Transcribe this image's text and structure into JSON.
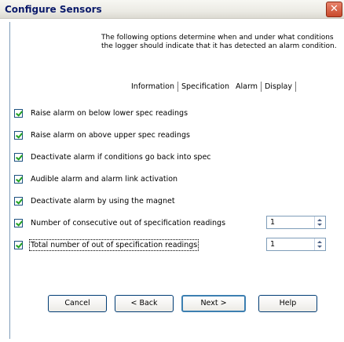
{
  "window": {
    "title": "Configure Sensors",
    "close_glyph": "✕"
  },
  "intro_text": "The following options determine when and under what conditions the logger should indicate that it has detected an alarm condition.",
  "tabs": [
    {
      "label": "Information"
    },
    {
      "label": "Specification"
    },
    {
      "label": "Alarm"
    },
    {
      "label": "Display"
    }
  ],
  "options": [
    {
      "label": "Raise alarm on below lower spec readings",
      "checked": true
    },
    {
      "label": "Raise alarm on above upper spec readings",
      "checked": true
    },
    {
      "label": "Deactivate alarm if conditions go back into spec",
      "checked": true
    },
    {
      "label": "Audible alarm and alarm link activation",
      "checked": true
    },
    {
      "label": "Deactivate alarm by using the magnet",
      "checked": true
    },
    {
      "label": "Number of consecutive out of specification readings",
      "checked": true,
      "spinner": "1"
    },
    {
      "label": "Total number of out of specification readings",
      "checked": true,
      "spinner": "1"
    }
  ],
  "buttons": {
    "cancel": "Cancel",
    "back": "< Back",
    "next": "Next >",
    "help": "Help"
  }
}
